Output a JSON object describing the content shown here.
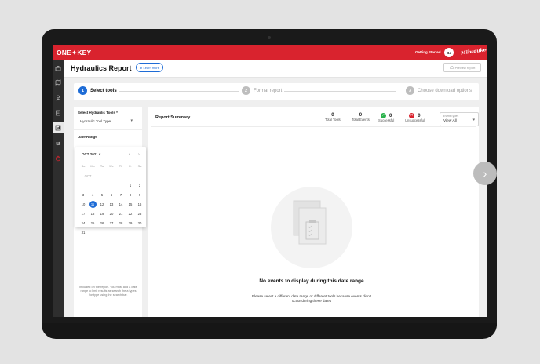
{
  "topbar": {
    "brand": "ONE✦KEY",
    "getting_started": "Getting Started",
    "avatar_initials": "BJ",
    "milwaukee": "Milwaukee",
    "color": "#d9232e"
  },
  "sidebar": {
    "icons": [
      "toolbox-icon",
      "map-icon",
      "person-icon",
      "document-icon",
      "report-icon",
      "transfer-icon",
      "power-icon"
    ]
  },
  "header": {
    "title": "Hydraulics Report",
    "learn_more": "⊕ Learn more",
    "preview": "Preview report"
  },
  "steps": [
    {
      "num": "1",
      "label": "Select tools"
    },
    {
      "num": "2",
      "label": "Format report"
    },
    {
      "num": "3",
      "label": "Choose download options"
    }
  ],
  "left_panel": {
    "tools_label": "Select Hydraulic Tools *",
    "tools_value": "Hydraulic Tool Type",
    "date_label": "Date Range",
    "note": "included on the report. You must add a date range to limit results as search the a types for type using the search bar."
  },
  "calendar": {
    "month": "OCT 2021 ▾",
    "days_of_week": [
      "Su",
      "Mo",
      "Tu",
      "We",
      "Th",
      "Fr",
      "Sa"
    ],
    "month_label": "OCT",
    "weeks": [
      [
        "",
        "",
        "",
        "",
        "",
        "1",
        "2"
      ],
      [
        "3",
        "4",
        "5",
        "6",
        "7",
        "8",
        "9"
      ],
      [
        "10",
        "11",
        "12",
        "13",
        "14",
        "15",
        "16"
      ],
      [
        "17",
        "18",
        "19",
        "20",
        "21",
        "22",
        "23"
      ],
      [
        "24",
        "25",
        "26",
        "27",
        "28",
        "29",
        "30"
      ],
      [
        "31",
        "",
        "",
        "",
        "",
        "",
        ""
      ]
    ],
    "selected": "11"
  },
  "summary": {
    "title": "Report Summary",
    "total_tools": {
      "value": "0",
      "label": "Total Tools"
    },
    "total_events": {
      "value": "0",
      "label": "Total Events"
    },
    "successful": {
      "value": "0",
      "label": "Successful",
      "color": "#2bb24c"
    },
    "unsuccessful": {
      "value": "0",
      "label": "Unsuccessful",
      "color": "#d9232e"
    },
    "event_type": {
      "caption": "Event Types",
      "value": "View All"
    }
  },
  "empty_state": {
    "title": "No events to display during this date range",
    "subtitle": "Please select a different date range or different tools because events didn't occur during these dates"
  }
}
